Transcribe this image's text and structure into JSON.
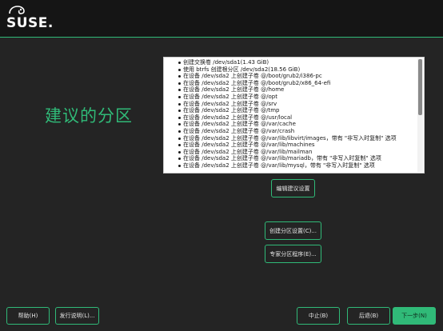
{
  "header": {
    "logo_text": "SUSE."
  },
  "page": {
    "title": "建议的分区"
  },
  "summary": {
    "items": [
      "创建交换卷 /dev/sda1(1.43 GiB)",
      "使用 btrfs 创建根分区 /dev/sda2(18.56 GiB)",
      "在设备 /dev/sda2 上创建子卷 @/boot/grub2/i386-pc",
      "在设备 /dev/sda2 上创建子卷 @/boot/grub2/x86_64-efi",
      "在设备 /dev/sda2 上创建子卷 @/home",
      "在设备 /dev/sda2 上创建子卷 @/opt",
      "在设备 /dev/sda2 上创建子卷 @/srv",
      "在设备 /dev/sda2 上创建子卷 @/tmp",
      "在设备 /dev/sda2 上创建子卷 @/usr/local",
      "在设备 /dev/sda2 上创建子卷 @/var/cache",
      "在设备 /dev/sda2 上创建子卷 @/var/crash",
      "在设备 /dev/sda2 上创建子卷 @/var/lib/libvirt/images，带有 \"非写入时复制\" 选项",
      "在设备 /dev/sda2 上创建子卷 @/var/lib/machines",
      "在设备 /dev/sda2 上创建子卷 @/var/lib/mailman",
      "在设备 /dev/sda2 上创建子卷 @/var/lib/mariadb，带有 \"非写入时复制\" 选项",
      "在设备 /dev/sda2 上创建子卷 @/var/lib/mysql，带有 \"非写入时复制\" 选项"
    ]
  },
  "buttons": {
    "edit": "编辑建议设置",
    "guided": "创建分区设置(C)...",
    "expert": "专家分区程序(E)...",
    "help": "帮助(H)",
    "release_notes": "发行说明(L)...",
    "abort": "中止(B)",
    "back": "后退(B)",
    "next": "下一步(N)"
  },
  "colors": {
    "accent": "#30ba78",
    "background": "#242424",
    "header": "#151515"
  }
}
